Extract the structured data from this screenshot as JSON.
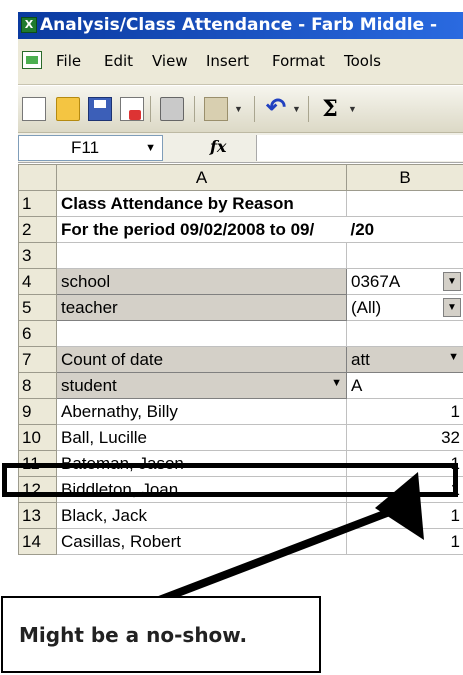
{
  "window": {
    "title": "Analysis/Class Attendance - Farb Middle -",
    "app_icon": "excel-icon"
  },
  "menu": {
    "items": [
      "File",
      "Edit",
      "View",
      "Insert",
      "Format",
      "Tools"
    ]
  },
  "toolbar": {
    "icons": [
      "new-icon",
      "open-icon",
      "save-icon",
      "permission-icon",
      "print-icon",
      "paste-icon",
      "undo-icon",
      "autosum-icon"
    ]
  },
  "formula_bar": {
    "name_box": "F11",
    "fx_label": "fx",
    "value": ""
  },
  "columns": {
    "a": "A",
    "b": "B"
  },
  "rows": [
    {
      "n": "1",
      "a": "Class Attendance by Reason",
      "b": ""
    },
    {
      "n": "2",
      "a": "For the period 09/02/2008 to 09/",
      "b": "/20"
    },
    {
      "n": "3",
      "a": "",
      "b": ""
    },
    {
      "n": "4",
      "a": "school",
      "b": "0367A"
    },
    {
      "n": "5",
      "a": "teacher",
      "b": "(All)"
    },
    {
      "n": "6",
      "a": "",
      "b": ""
    },
    {
      "n": "7",
      "a": "Count of date",
      "b": "att"
    },
    {
      "n": "8",
      "a": "student",
      "b": "A"
    },
    {
      "n": "9",
      "a": "Abernathy, Billy",
      "b": "1"
    },
    {
      "n": "10",
      "a": "Ball, Lucille",
      "b": "32"
    },
    {
      "n": "11",
      "a": "Bateman, Jason",
      "b": "1"
    },
    {
      "n": "12",
      "a": "Biddleton, Joan",
      "b": "1"
    },
    {
      "n": "13",
      "a": "Black, Jack",
      "b": "1"
    },
    {
      "n": "14",
      "a": "Casillas, Robert",
      "b": "1"
    }
  ],
  "callout": {
    "text": "Might be a no-show."
  },
  "colors": {
    "title_bar": "#0a3aa0",
    "highlight": "#000000"
  }
}
